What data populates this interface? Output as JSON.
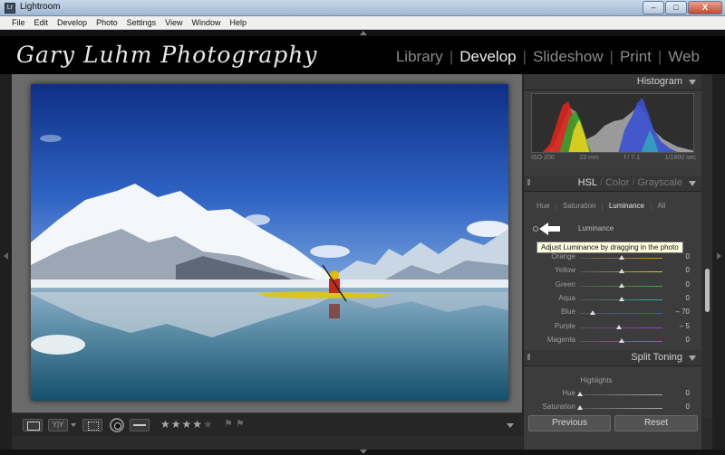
{
  "window": {
    "title": "Lightroom",
    "app_icon": "Lr",
    "minimize": "–",
    "maximize": "□",
    "close": "X"
  },
  "menu": [
    "File",
    "Edit",
    "Develop",
    "Photo",
    "Settings",
    "View",
    "Window",
    "Help"
  ],
  "identity": {
    "plate": "Gary Luhm Photography"
  },
  "modules": [
    {
      "label": "Library",
      "active": false
    },
    {
      "label": "Develop",
      "active": true
    },
    {
      "label": "Slideshow",
      "active": false
    },
    {
      "label": "Print",
      "active": false
    },
    {
      "label": "Web",
      "active": false
    }
  ],
  "histogram": {
    "title": "Histogram",
    "iso": "ISO 200",
    "focal": "23 mm",
    "aperture": "f / 7.1",
    "shutter": "1/1600 sec"
  },
  "hsl": {
    "title_hsl": "HSL",
    "title_color": "Color",
    "title_grayscale": "Grayscale",
    "tabs": [
      "Hue",
      "Saturation",
      "Luminance",
      "All"
    ],
    "active_tab": "Luminance",
    "section_label": "Luminance",
    "tooltip": "Adjust Luminance by dragging in the photo",
    "sliders": [
      {
        "label": "Orange",
        "value": "0",
        "level": 0,
        "color": "#e08a2a"
      },
      {
        "label": "Yellow",
        "value": "0",
        "level": 0,
        "color": "#d8cf2a"
      },
      {
        "label": "Green",
        "value": "0",
        "level": 0,
        "color": "#3faa3f"
      },
      {
        "label": "Aqua",
        "value": "0",
        "level": 0,
        "color": "#2fb0b0"
      },
      {
        "label": "Blue",
        "value": "– 70",
        "level": -70,
        "color": "#3a5ad8"
      },
      {
        "label": "Purple",
        "value": "– 5",
        "level": -5,
        "color": "#9a3ad8"
      },
      {
        "label": "Magenta",
        "value": "0",
        "level": 0,
        "color": "#d83ab0"
      }
    ]
  },
  "split_toning": {
    "title": "Split Toning",
    "highlights_label": "Highlights",
    "sliders": [
      {
        "label": "Hue",
        "value": "0",
        "level": 0,
        "color": "#aaaaaa"
      },
      {
        "label": "Saturation",
        "value": "0",
        "level": 0,
        "color": "#aaaaaa"
      }
    ]
  },
  "toolbar": {
    "rating": "★★★★",
    "rating_empty": "★",
    "flags": "⚑ ⚑"
  },
  "buttons": {
    "previous": "Previous",
    "reset": "Reset"
  }
}
